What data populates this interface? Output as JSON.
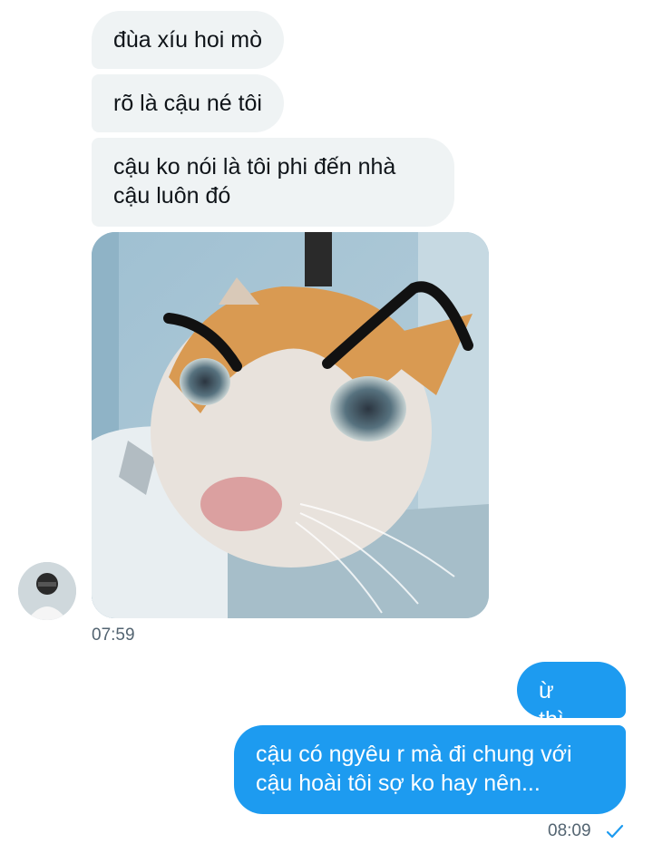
{
  "incoming": {
    "messages": [
      "đùa xíu hoi mò",
      "rõ là cậu né tôi",
      "cậu ko nói là tôi phi đến nhà cậu luôn đó"
    ],
    "time": "07:59"
  },
  "outgoing": {
    "messages": [
      "ừ thì...",
      "cậu có ngyêu r mà đi chung với cậu hoài tôi sợ ko hay nên..."
    ],
    "time": "08:09"
  },
  "icons": {
    "read_receipt": "checkmark-icon",
    "avatar": "user-avatar",
    "photo": "cat-meme-photo"
  },
  "colors": {
    "incoming_bubble": "#eff3f4",
    "outgoing_bubble": "#1d9bf0",
    "timestamp": "#536471"
  }
}
